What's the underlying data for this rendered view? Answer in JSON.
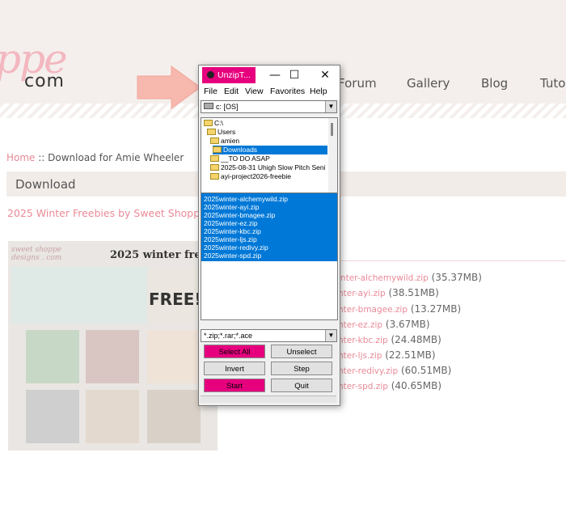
{
  "site": {
    "logo_script": "ppe",
    "logo_domain": "com",
    "nav": [
      "Forum",
      "Gallery",
      "Blog",
      "Tuto"
    ]
  },
  "breadcrumb": {
    "home": "Home",
    "sep": " :: ",
    "current": "Download for Amie Wheeler"
  },
  "page_title": "Download",
  "subtitle": "2025 Winter Freebies by Sweet Shoppe",
  "promo": {
    "brand": "sweet shoppe designs . com",
    "title": "2025 winter freeb",
    "free_text": "FREE!"
  },
  "downloads": [
    {
      "link": "inter-alchemywild.zip",
      "size": "(35.37MB)"
    },
    {
      "link": "nter-ayi.zip",
      "size": "(38.51MB)"
    },
    {
      "link": "nter-bmagee.zip",
      "size": "(13.27MB)"
    },
    {
      "link": "nter-ez.zip",
      "size": "(3.67MB)"
    },
    {
      "link": "nter-kbc.zip",
      "size": "(24.48MB)"
    },
    {
      "link": "nter-ljs.zip",
      "size": "(22.51MB)"
    },
    {
      "link": "nter-redivy.zip",
      "size": "(60.51MB)"
    },
    {
      "link": "nter-spd.zip",
      "size": "(40.65MB)"
    }
  ],
  "window": {
    "title": "UnzipT...",
    "controls": {
      "minimize": "—",
      "maximize": "☐",
      "close": "✕"
    },
    "menu": [
      "File",
      "Edit",
      "View",
      "Favorites",
      "Help"
    ],
    "drive": "c: [OS]",
    "tree": [
      "C:\\",
      "Users",
      "amien",
      "Downloads",
      "__TO DO ASAP",
      "2025-08-31 Uhigh Slow Pitch Seni",
      "ayi-project2026-freebie"
    ],
    "files": [
      "2025winter-alchemywild.zip",
      "2025winter-ayi.zip",
      "2025winter-bmagee.zip",
      "2025winter-ez.zip",
      "2025winter-kbc.zip",
      "2025winter-ljs.zip",
      "2025winter-redivy.zip",
      "2025winter-spd.zip"
    ],
    "filter": "*.zip;*.rar;*.ace",
    "buttons": {
      "select_all": "Select All",
      "unselect": "Unselect",
      "invert": "Invert",
      "step": "Step",
      "start": "Start",
      "quit": "Quit"
    }
  },
  "colors": {
    "accent_pink": "#e6007e",
    "selection_blue": "#0078d7",
    "link_pink": "#e98a97",
    "header_bg": "#f4efec"
  }
}
